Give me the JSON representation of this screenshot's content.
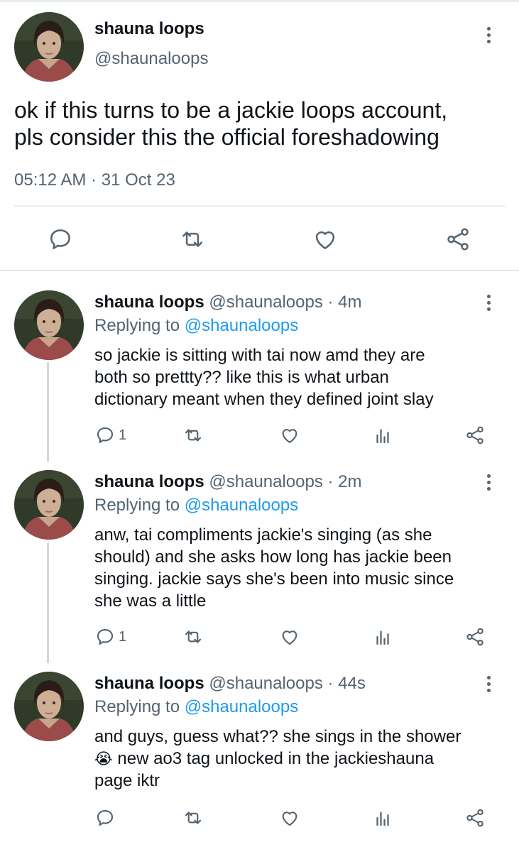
{
  "main_tweet": {
    "name": "shauna loops",
    "handle": "@shaunaloops",
    "text_line1": "ok if this turns to be a jackie loops account,",
    "text_line2": "pls consider this the official foreshadowing",
    "timestamp": "05:12 AM · 31 Oct 23",
    "icons": [
      "reply-icon",
      "retweet-icon",
      "like-icon",
      "share-icon"
    ]
  },
  "replies": [
    {
      "name": "shauna loops",
      "handle": "@shaunaloops",
      "time": "· 4m",
      "replying_prefix": "Replying to",
      "replying_handle": "@shaunaloops",
      "lines": [
        "so jackie is sitting with tai now amd they are",
        "both so prettty?? like this is what urban",
        "dictionary meant when they defined joint slay"
      ],
      "reply_count": "1"
    },
    {
      "name": "shauna loops",
      "handle": "@shaunaloops",
      "time": "· 2m",
      "replying_prefix": "Replying to",
      "replying_handle": "@shaunaloops",
      "lines": [
        "anw, tai compliments jackie's singing (as she",
        "should) and she asks how long has jackie been",
        "singing. jackie says she's been into music since",
        "she was a little"
      ],
      "reply_count": "1"
    },
    {
      "name": "shauna loops",
      "handle": "@shaunaloops",
      "time": "· 44s",
      "replying_prefix": "Replying to",
      "replying_handle": "@shaunaloops",
      "lines": [
        "and guys, guess what?? she sings in the shower",
        " new ao3 tag unlocked in the jackieshauna",
        "page iktr"
      ],
      "emoji": "😭",
      "reply_count": ""
    }
  ],
  "colors": {
    "accent": "#1d9bf0",
    "secondary_text": "#536471",
    "icon": "#536471"
  }
}
